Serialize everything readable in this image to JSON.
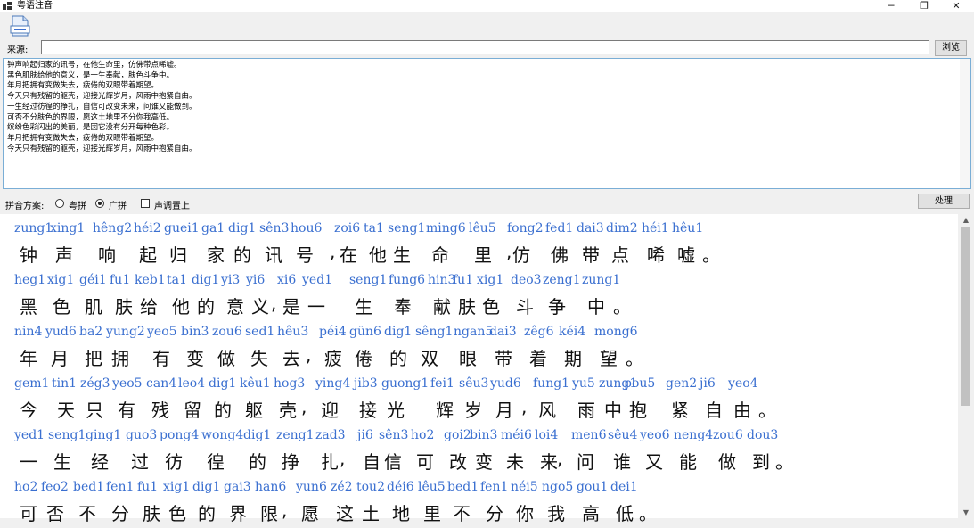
{
  "window": {
    "title": "粤语注音",
    "minimize_glyph": "─",
    "maximize_glyph": "❐",
    "close_glyph": "✕",
    "icon": "app-window-icon"
  },
  "toolbar": {
    "open_icon": "document-icon"
  },
  "source": {
    "label": "来源:",
    "value": "",
    "browse_label": "浏览"
  },
  "editor": {
    "lines": [
      "钟声响起归家的讯号，在他生命里，仿佛带点唏嘘。",
      "黑色肌肤给他的意义，是一生奉献，肤色斗争中。",
      "年月把拥有变做失去，疲倦的双眼带着期望。",
      "今天只有残留的躯壳，迎接光辉岁月，风雨中抱紧自由。",
      "一生经过彷徨的挣扎，自信可改变未来，问谁又能做到。",
      "可否不分肤色的界限，愿这土地里不分你我高低。",
      "缤纷色彩闪出的美丽，是因它没有分开每种色彩。",
      "年月把拥有变做失去，疲倦的双眼带着期望。",
      "今天只有残留的躯壳，迎接光辉岁月，风雨中抱紧自由。"
    ]
  },
  "options": {
    "scheme_label": "拼音方案:",
    "radio_yuepin": "粤拼",
    "radio_guangpin": "广拼",
    "selected": "广拼",
    "tone_top_label": "声调置上",
    "tone_top_checked": false,
    "process_label": "处理"
  },
  "result": {
    "rows": [
      {
        "tokens": [
          {
            "py": "zung1",
            "hz": "钟"
          },
          {
            "py": "xing1",
            "hz": "声"
          },
          {
            "py": "hêng2",
            "hz": "响"
          },
          {
            "py": "héi2",
            "hz": "起"
          },
          {
            "py": "guei1",
            "hz": "归"
          },
          {
            "py": "ga1",
            "hz": "家"
          },
          {
            "py": "dig1",
            "hz": "的"
          },
          {
            "py": "sên3",
            "hz": "讯"
          },
          {
            "py": "hou6",
            "hz": "号"
          },
          {
            "py": "",
            "hz": ","
          },
          {
            "py": "zoi6",
            "hz": "在"
          },
          {
            "py": "ta1",
            "hz": "他"
          },
          {
            "py": "seng1",
            "hz": "生"
          },
          {
            "py": "ming6",
            "hz": "命"
          },
          {
            "py": "lêu5",
            "hz": "里"
          },
          {
            "py": "",
            "hz": ","
          },
          {
            "py": "fong2",
            "hz": "仿"
          },
          {
            "py": "fed1",
            "hz": "佛"
          },
          {
            "py": "dai3",
            "hz": "带"
          },
          {
            "py": "dim2",
            "hz": "点"
          },
          {
            "py": "héi1",
            "hz": "唏"
          },
          {
            "py": "hêu1",
            "hz": "嘘"
          },
          {
            "py": "",
            "hz": "。"
          }
        ]
      },
      {
        "tokens": [
          {
            "py": "heg1",
            "hz": "黑"
          },
          {
            "py": "xig1",
            "hz": "色"
          },
          {
            "py": "géi1",
            "hz": "肌"
          },
          {
            "py": "fu1",
            "hz": "肤"
          },
          {
            "py": "keb1",
            "hz": "给"
          },
          {
            "py": "ta1",
            "hz": "他"
          },
          {
            "py": "dig1",
            "hz": "的"
          },
          {
            "py": "yi3",
            "hz": "意"
          },
          {
            "py": "yi6",
            "hz": "义"
          },
          {
            "py": "",
            "hz": ","
          },
          {
            "py": "xi6",
            "hz": "是"
          },
          {
            "py": "yed1",
            "hz": "一"
          },
          {
            "py": "seng1",
            "hz": "生"
          },
          {
            "py": "fung6",
            "hz": "奉"
          },
          {
            "py": "hin3",
            "hz": "献"
          },
          {
            "py": "",
            "hz": ","
          },
          {
            "py": "fu1",
            "hz": "肤"
          },
          {
            "py": "xig1",
            "hz": "色"
          },
          {
            "py": "deo3",
            "hz": "斗"
          },
          {
            "py": "zeng1",
            "hz": "争"
          },
          {
            "py": "zung1",
            "hz": "中"
          },
          {
            "py": "",
            "hz": "。"
          }
        ]
      },
      {
        "tokens": [
          {
            "py": "nin4",
            "hz": "年"
          },
          {
            "py": "yud6",
            "hz": "月"
          },
          {
            "py": "ba2",
            "hz": "把"
          },
          {
            "py": "yung2",
            "hz": "拥"
          },
          {
            "py": "yeo5",
            "hz": "有"
          },
          {
            "py": "bin3",
            "hz": "变"
          },
          {
            "py": "zou6",
            "hz": "做"
          },
          {
            "py": "sed1",
            "hz": "失"
          },
          {
            "py": "hêu3",
            "hz": "去"
          },
          {
            "py": "",
            "hz": ","
          },
          {
            "py": "péi4",
            "hz": "疲"
          },
          {
            "py": "gün6",
            "hz": "倦"
          },
          {
            "py": "dig1",
            "hz": "的"
          },
          {
            "py": "sêng1",
            "hz": "双"
          },
          {
            "py": "ngan5",
            "hz": "眼"
          },
          {
            "py": "dai3",
            "hz": "带"
          },
          {
            "py": "zêg6",
            "hz": "着"
          },
          {
            "py": "kéi4",
            "hz": "期"
          },
          {
            "py": "mong6",
            "hz": "望"
          },
          {
            "py": "",
            "hz": "。"
          }
        ]
      },
      {
        "tokens": [
          {
            "py": "gem1",
            "hz": "今"
          },
          {
            "py": "tin1",
            "hz": "天"
          },
          {
            "py": "zég3",
            "hz": "只"
          },
          {
            "py": "yeo5",
            "hz": "有"
          },
          {
            "py": "can4",
            "hz": "残"
          },
          {
            "py": "leo4",
            "hz": "留"
          },
          {
            "py": "dig1",
            "hz": "的"
          },
          {
            "py": "kêu1",
            "hz": "躯"
          },
          {
            "py": "hog3",
            "hz": "壳"
          },
          {
            "py": "",
            "hz": ","
          },
          {
            "py": "ying4",
            "hz": "迎"
          },
          {
            "py": "jib3",
            "hz": "接"
          },
          {
            "py": "guong1",
            "hz": "光"
          },
          {
            "py": "fei1",
            "hz": "辉"
          },
          {
            "py": "sêu3",
            "hz": "岁"
          },
          {
            "py": "yud6",
            "hz": "月"
          },
          {
            "py": "",
            "hz": ","
          },
          {
            "py": "fung1",
            "hz": "风"
          },
          {
            "py": "yu5",
            "hz": "雨"
          },
          {
            "py": "zung1",
            "hz": "中"
          },
          {
            "py": "pou5",
            "hz": "抱"
          },
          {
            "py": "gen2",
            "hz": "紧"
          },
          {
            "py": "ji6",
            "hz": "自"
          },
          {
            "py": "yeo4",
            "hz": "由"
          },
          {
            "py": "",
            "hz": "。"
          }
        ]
      },
      {
        "tokens": [
          {
            "py": "yed1",
            "hz": "一"
          },
          {
            "py": "seng1",
            "hz": "生"
          },
          {
            "py": "ging1",
            "hz": "经"
          },
          {
            "py": "guo3",
            "hz": "过"
          },
          {
            "py": "pong4",
            "hz": "彷"
          },
          {
            "py": "wong4",
            "hz": "徨"
          },
          {
            "py": "dig1",
            "hz": "的"
          },
          {
            "py": "zeng1",
            "hz": "挣"
          },
          {
            "py": "zad3",
            "hz": "扎"
          },
          {
            "py": "",
            "hz": ","
          },
          {
            "py": "ji6",
            "hz": "自"
          },
          {
            "py": "sên3",
            "hz": "信"
          },
          {
            "py": "ho2",
            "hz": "可"
          },
          {
            "py": "goi2",
            "hz": "改"
          },
          {
            "py": "bin3",
            "hz": "变"
          },
          {
            "py": "méi6",
            "hz": "未"
          },
          {
            "py": "loi4",
            "hz": "来"
          },
          {
            "py": "",
            "hz": ","
          },
          {
            "py": "men6",
            "hz": "问"
          },
          {
            "py": "sêu4",
            "hz": "谁"
          },
          {
            "py": "yeo6",
            "hz": "又"
          },
          {
            "py": "neng4",
            "hz": "能"
          },
          {
            "py": "zou6",
            "hz": "做"
          },
          {
            "py": "dou3",
            "hz": "到"
          },
          {
            "py": "",
            "hz": "。"
          }
        ]
      },
      {
        "tokens": [
          {
            "py": "ho2",
            "hz": "可"
          },
          {
            "py": "feo2",
            "hz": "否"
          },
          {
            "py": "bed1",
            "hz": "不"
          },
          {
            "py": "fen1",
            "hz": "分"
          },
          {
            "py": "fu1",
            "hz": "肤"
          },
          {
            "py": "xig1",
            "hz": "色"
          },
          {
            "py": "dig1",
            "hz": "的"
          },
          {
            "py": "gai3",
            "hz": "界"
          },
          {
            "py": "han6",
            "hz": "限"
          },
          {
            "py": "",
            "hz": ","
          },
          {
            "py": "yun6",
            "hz": "愿"
          },
          {
            "py": "zé2",
            "hz": "这"
          },
          {
            "py": "tou2",
            "hz": "土"
          },
          {
            "py": "déi6",
            "hz": "地"
          },
          {
            "py": "lêu5",
            "hz": "里"
          },
          {
            "py": "bed1",
            "hz": "不"
          },
          {
            "py": "fen1",
            "hz": "分"
          },
          {
            "py": "néi5",
            "hz": "你"
          },
          {
            "py": "ngo5",
            "hz": "我"
          },
          {
            "py": "gou1",
            "hz": "高"
          },
          {
            "py": "dei1",
            "hz": "低"
          },
          {
            "py": "",
            "hz": "。"
          }
        ]
      }
    ]
  }
}
